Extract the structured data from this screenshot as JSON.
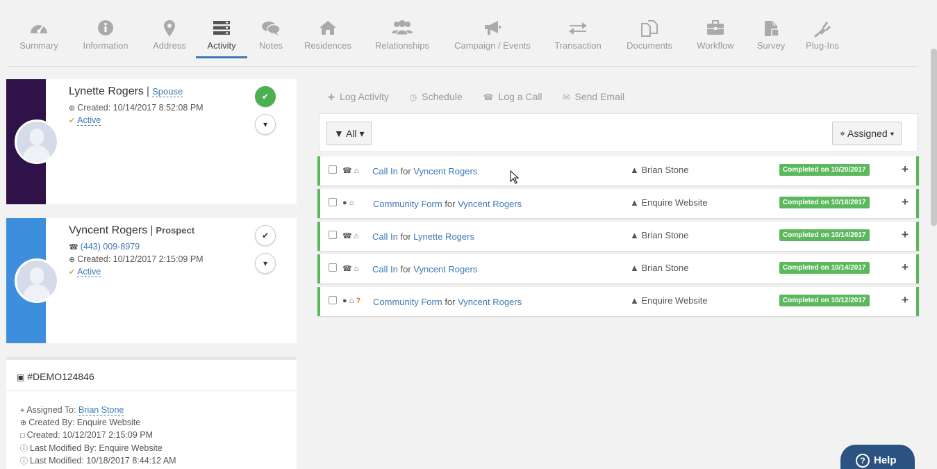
{
  "nav": {
    "tabs": [
      {
        "label": "Summary",
        "icon": "dashboard-icon"
      },
      {
        "label": "Information",
        "icon": "info-icon"
      },
      {
        "label": "Address",
        "icon": "map-marker-icon"
      },
      {
        "label": "Activity",
        "icon": "server-icon",
        "active": true
      },
      {
        "label": "Notes",
        "icon": "comments-icon"
      },
      {
        "label": "Residences",
        "icon": "home-icon"
      },
      {
        "label": "Relationships",
        "icon": "users-icon"
      },
      {
        "label": "Campaign / Events",
        "icon": "bullhorn-icon"
      },
      {
        "label": "Transaction",
        "icon": "exchange-icon"
      },
      {
        "label": "Documents",
        "icon": "files-icon"
      },
      {
        "label": "Workflow",
        "icon": "briefcase-icon"
      },
      {
        "label": "Survey",
        "icon": "survey-icon"
      },
      {
        "label": "Plug-Ins",
        "icon": "plug-icon"
      }
    ]
  },
  "contacts": [
    {
      "name": "Lynette Rogers",
      "role": "Spouse",
      "created": "Created: 10/14/2017 8:52:08 PM",
      "status": "Active",
      "stripe_color": "#2f1248"
    },
    {
      "name": "Vyncent Rogers",
      "role": "Prospect",
      "phone": "(443) 009-8979",
      "created": "Created: 10/12/2017 2:15:09 PM",
      "status": "Active",
      "stripe_color": "#3d8fdd"
    }
  ],
  "case": {
    "id": "#DEMO124846",
    "assigned_label": "Assigned To:",
    "assigned_to": "Brian Stone",
    "created_by": "Created By: Enquire Website",
    "created": "Created: 10/12/2017 2:15:09 PM",
    "modified_by": "Last Modified By: Enquire Website",
    "modified": "Last Modified: 10/18/2017 8:44:12 AM"
  },
  "actions": {
    "log_activity": "Log Activity",
    "schedule": "Schedule",
    "log_call": "Log a Call",
    "send_email": "Send Email"
  },
  "filter": {
    "all_label": "All",
    "assigned_label": "Assigned"
  },
  "activities": [
    {
      "type": "Call In",
      "for": "for",
      "who": "Vyncent Rogers",
      "icons": "phone",
      "user": "Brian Stone",
      "status": "Completed on 10/20/2017"
    },
    {
      "type": "Community Form",
      "for": "for",
      "who": "Vyncent Rogers",
      "icons": "globe",
      "user": "Enquire Website",
      "status": "Completed on 10/18/2017"
    },
    {
      "type": "Call In",
      "for": "for",
      "who": "Lynette Rogers",
      "icons": "phone",
      "user": "Brian Stone",
      "status": "Completed on 10/14/2017"
    },
    {
      "type": "Call In",
      "for": "for",
      "who": "Vyncent Rogers",
      "icons": "phone",
      "user": "Brian Stone",
      "status": "Completed on 10/14/2017"
    },
    {
      "type": "Community Form",
      "for": "for",
      "who": "Vyncent Rogers",
      "icons": "globe-question",
      "user": "Enquire Website",
      "status": "Completed on 10/12/2017"
    }
  ],
  "help": {
    "label": "Help"
  },
  "colors": {
    "accent": "#3c79b5",
    "success": "#5cb85c",
    "help_bg": "#2b5381"
  }
}
